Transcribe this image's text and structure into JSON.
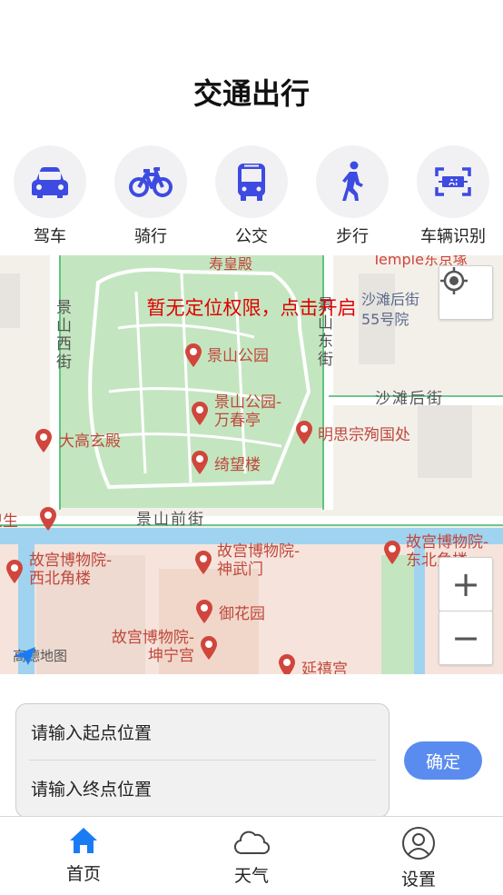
{
  "page": {
    "title": "交通出行"
  },
  "modes": [
    {
      "label": "驾车",
      "icon": "car-icon"
    },
    {
      "label": "骑行",
      "icon": "bicycle-icon"
    },
    {
      "label": "公交",
      "icon": "bus-icon"
    },
    {
      "label": "步行",
      "icon": "walk-icon"
    },
    {
      "label": "车辆识别",
      "icon": "ai-scan-icon"
    }
  ],
  "map": {
    "permission_notice": "暂无定位权限，点击开启",
    "logo": "高德地图",
    "zoom_in": "+",
    "zoom_out": "−",
    "labels": {
      "temple": "Temple东京塚",
      "shouhuang": "寿皇殿",
      "jingshan_west": "景山西街",
      "jingshan_east": "景山东街",
      "shatan_55": "沙滩后街55号院",
      "shatan_hou": "沙滩后街",
      "jingshan_park": "景山公园",
      "wanchun": "景山公园-万春亭",
      "dagaoxuan": "大高玄殿",
      "mingsi": "明思宗殉国处",
      "qiwang": "绮望楼",
      "jingshan_front": "景山前街",
      "weisheng": "卫生",
      "gugong_nw": "故宫博物院-西北角楼",
      "gugong_shenwu": "故宫博物院-神武门",
      "gugong_ne": "故宫博物院-东北角楼",
      "yuhuayuan": "御花园",
      "gugong_kunning": "故宫博物院-坤宁宫",
      "yanxi": "延禧宫"
    }
  },
  "form": {
    "start_placeholder": "请输入起点位置",
    "end_placeholder": "请输入终点位置",
    "confirm_label": "确定"
  },
  "tabs": [
    {
      "label": "首页",
      "icon": "home-icon",
      "active": true
    },
    {
      "label": "天气",
      "icon": "cloud-icon",
      "active": false
    },
    {
      "label": "设置",
      "icon": "user-icon",
      "active": false
    }
  ],
  "colors": {
    "accent": "#3d4be0",
    "tab_active": "#1a7cf5",
    "confirm": "#5a8cf0",
    "notice": "#e00000",
    "poi": "#d0463c"
  }
}
